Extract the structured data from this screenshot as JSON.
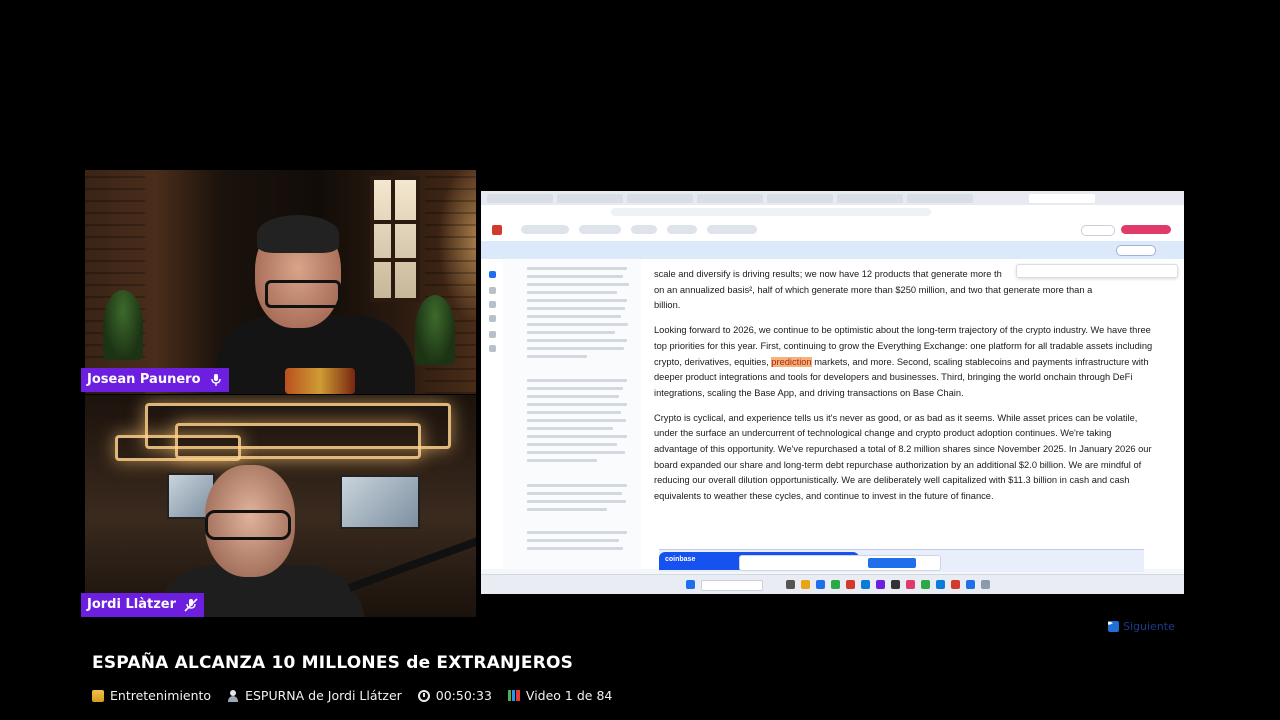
{
  "participants": [
    {
      "name": "Josean Paunero",
      "mic": "mic-on"
    },
    {
      "name": "Jordi Llàtzer",
      "mic": "mic-muted"
    }
  ],
  "next_label": "Siguiente",
  "video_title": "ESPAÑA ALCANZA 10 MILLONES de EXTRANJEROS",
  "meta": {
    "category": "Entretenimiento",
    "author": "ESPURNA de Jordi Llátzer",
    "duration": "00:50:33",
    "position": "Video 1 de 84"
  },
  "document": {
    "p1a": "scale and diversify is driving results; we now have 12 products that generate more th",
    "p1b": "on an annualized basis², half of which generate more than $250 million, and two that generate more than a",
    "p1c": "billion.",
    "p2a": "Looking forward to 2026, we continue to be optimistic about the long-term trajectory of the crypto industry. We have three top priorities for this year. First, continuing to grow the Everything Exchange: one platform for all tradable assets including crypto, derivatives, equities, ",
    "p2highlight": "prediction",
    "p2b": " markets, and more. Second, scaling stablecoins and payments infrastructure with deeper product integrations and tools for developers and businesses. Third, bringing the world onchain through DeFi integrations, scaling the Base App, and driving transactions on Base Chain.",
    "p3": "Crypto is cyclical, and experience tells us it's never as good, or as bad as it seems. While asset prices can be volatile, under the surface an undercurrent of technological change and crypto product adoption continues. We're taking advantage of this opportunity. We've repurchased a total of 8.2 million shares since November 2025. In January 2026 our board expanded our share and long-term debt repurchase authorization by an additional $2.0 billion. We are mindful of reducing our overall dilution opportunistically. We are deliberately well capitalized with $11.3 billion in cash and cash equivalents to weather these cycles, and continue to invest in the future of finance.",
    "coinbase": "coinbase"
  },
  "colors": {
    "nameplate": "#6d1fe0",
    "highlight": "#f4b27c",
    "next": "#1a3c8c"
  }
}
